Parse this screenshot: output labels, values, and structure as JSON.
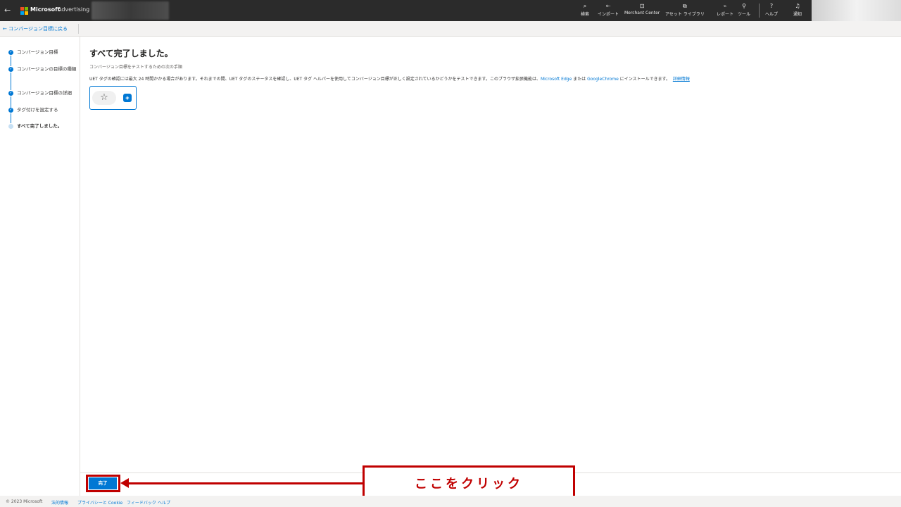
{
  "topbar": {
    "brand": "Microsoft",
    "product": "Advertising",
    "nav": [
      {
        "icon": "⌕",
        "label": "検索"
      },
      {
        "icon": "⇠",
        "label": "インポート"
      },
      {
        "icon": "⊡",
        "label": "Merchant Center"
      },
      {
        "icon": "⧉",
        "label": "アセット ライブラリ"
      },
      {
        "icon": "⌁",
        "label": "レポート"
      },
      {
        "icon": "⚲",
        "label": "ツール"
      },
      {
        "icon": "?",
        "label": "ヘルプ"
      },
      {
        "icon": "♫",
        "label": "通知"
      }
    ]
  },
  "breadcrumb": {
    "back_label": "コンバージョン目標に戻る"
  },
  "steps": [
    {
      "label": "コンバージョン目標",
      "status": "done"
    },
    {
      "label": "コンバージョンの目標の種類",
      "status": "done"
    },
    {
      "label": "コンバージョン目標の詳細",
      "status": "done"
    },
    {
      "label": "タグ付けを設定する",
      "status": "done"
    },
    {
      "label": "すべて完了しました。",
      "status": "current"
    }
  ],
  "main": {
    "title": "すべて完了しました。",
    "subheading": "コンバージョン目標をテストするための次の手順",
    "desc_text": "UET タグの確認には最大 24 時間かかる場合があります。それまでの間、UET タグのステータスを確認し、UET タグ ヘルパーを使用してコンバージョン目標が正しく設定されているかどうかをテストできます。このブラウザ拡張機能は、",
    "link_edge": "Microsoft Edge",
    "desc_or": " または ",
    "link_chrome": "GoogleChrome",
    "desc_tail": " にインストールできます。",
    "link_more": "詳細情報"
  },
  "actions": {
    "done_label": "完了"
  },
  "annotation": {
    "callout_text": "ここをクリック"
  },
  "footer": {
    "copyright": "© 2023 Microsoft",
    "links": [
      "法的情報",
      "プライバシーと Cookie",
      "フィードバック",
      "ヘルプ"
    ]
  },
  "colors": {
    "accent": "#0078d4",
    "annotation": "#c00000",
    "topbar": "#2b2b2b"
  }
}
